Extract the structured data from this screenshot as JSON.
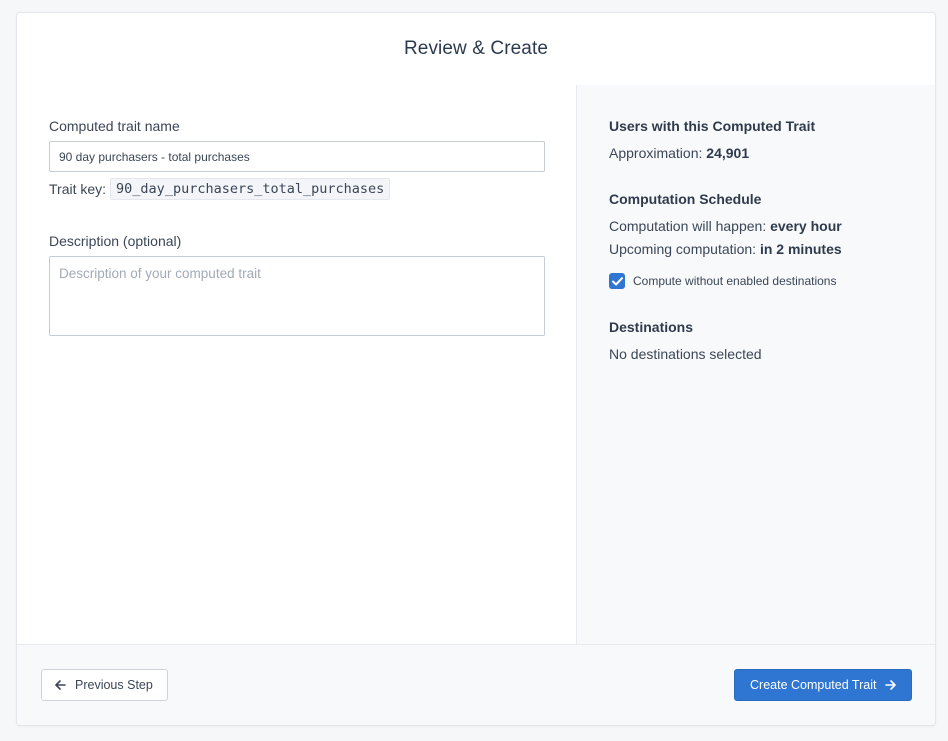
{
  "header": {
    "title": "Review & Create"
  },
  "form": {
    "name_label": "Computed trait name",
    "name_value": "90 day purchasers - total purchases",
    "trait_key_label": "Trait key:",
    "trait_key_value": "90_day_purchasers_total_purchases",
    "description_label": "Description (optional)",
    "description_placeholder": "Description of your computed trait",
    "description_value": ""
  },
  "summary": {
    "users": {
      "title": "Users with this Computed Trait",
      "approx_label": "Approximation:",
      "approx_value": "24,901"
    },
    "schedule": {
      "title": "Computation Schedule",
      "frequency_label": "Computation will happen:",
      "frequency_value": "every hour",
      "upcoming_label": "Upcoming computation:",
      "upcoming_value": "in 2 minutes",
      "checkbox_label": "Compute without enabled destinations",
      "checkbox_checked": true
    },
    "destinations": {
      "title": "Destinations",
      "empty_text": "No destinations selected"
    }
  },
  "footer": {
    "prev_label": "Previous Step",
    "create_label": "Create Computed Trait"
  },
  "colors": {
    "accent": "#2f76d2",
    "text": "#3b4656",
    "pane_bg": "#f8f9fb"
  },
  "icons": {
    "prev": "arrow-left-icon",
    "create": "arrow-right-icon",
    "check": "check-icon"
  }
}
